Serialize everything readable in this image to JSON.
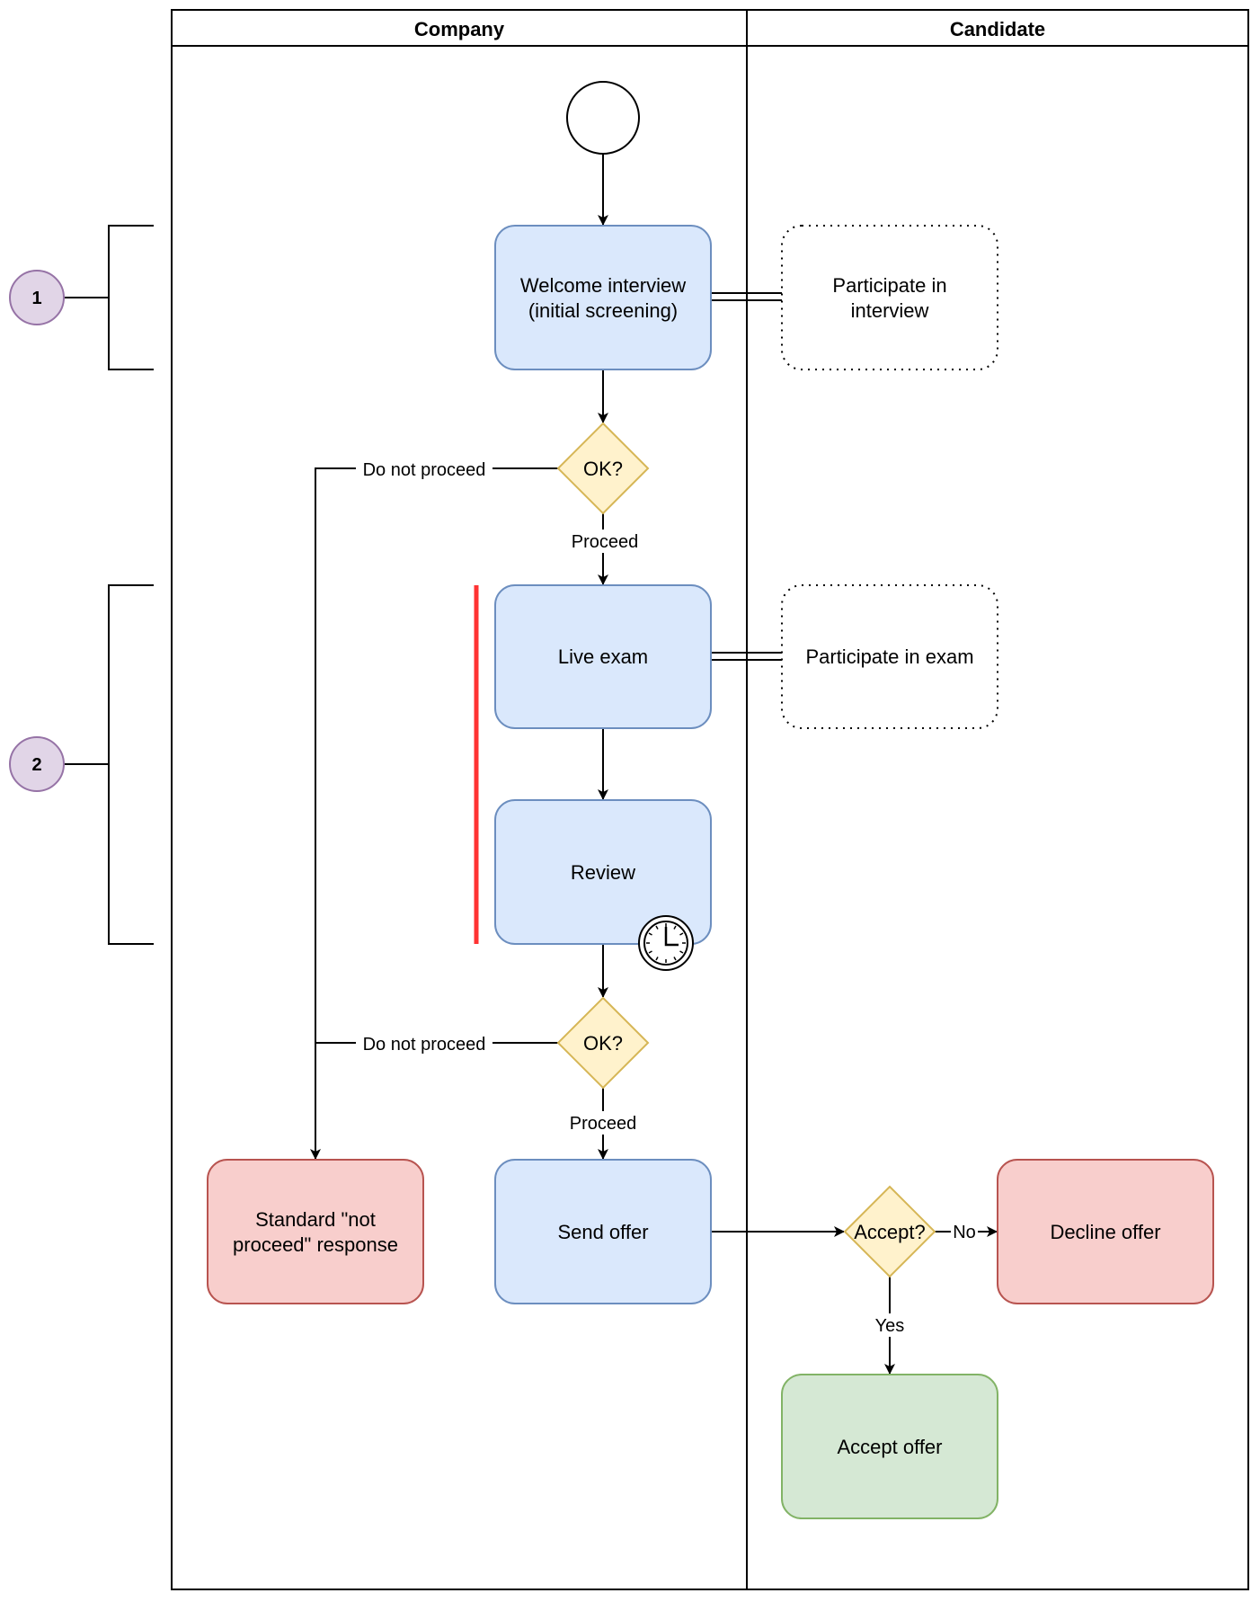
{
  "pool": {
    "lanes": [
      {
        "id": "company",
        "title": "Company"
      },
      {
        "id": "candidate",
        "title": "Candidate"
      }
    ]
  },
  "colors": {
    "task_fill": "#dae8fc",
    "task_stroke": "#6c8ebf",
    "decision_fill": "#fff2cc",
    "decision_stroke": "#d6b656",
    "negative_fill": "#f8cecc",
    "negative_stroke": "#b85450",
    "positive_fill": "#d5e8d4",
    "positive_stroke": "#82b366",
    "badge_fill": "#e1d5e7",
    "badge_stroke": "#9673a6",
    "highlight_bar": "#ff3333"
  },
  "nodes": {
    "start": {
      "type": "start-event"
    },
    "welcome_interview": {
      "lines": [
        "Welcome interview",
        "(initial screening)"
      ]
    },
    "participate_interview": {
      "lines": [
        "Participate in",
        "interview"
      ]
    },
    "ok1": {
      "label": "OK?"
    },
    "live_exam": {
      "lines": [
        "Live exam"
      ]
    },
    "participate_exam": {
      "lines": [
        "Participate in exam"
      ]
    },
    "review": {
      "lines": [
        "Review"
      ],
      "icon": "clock-icon"
    },
    "ok2": {
      "label": "OK?"
    },
    "not_proceed": {
      "lines": [
        "Standard \"not",
        "proceed\" response"
      ]
    },
    "send_offer": {
      "lines": [
        "Send offer"
      ]
    },
    "accept": {
      "label": "Accept?"
    },
    "decline_offer": {
      "lines": [
        "Decline offer"
      ]
    },
    "accept_offer": {
      "lines": [
        "Accept offer"
      ]
    }
  },
  "edges": {
    "dnp1": "Do not proceed",
    "proceed1": "Proceed",
    "dnp2": "Do not proceed",
    "proceed2": "Proceed",
    "no": "No",
    "yes": "Yes"
  },
  "badges": [
    {
      "label": "1"
    },
    {
      "label": "2"
    }
  ]
}
